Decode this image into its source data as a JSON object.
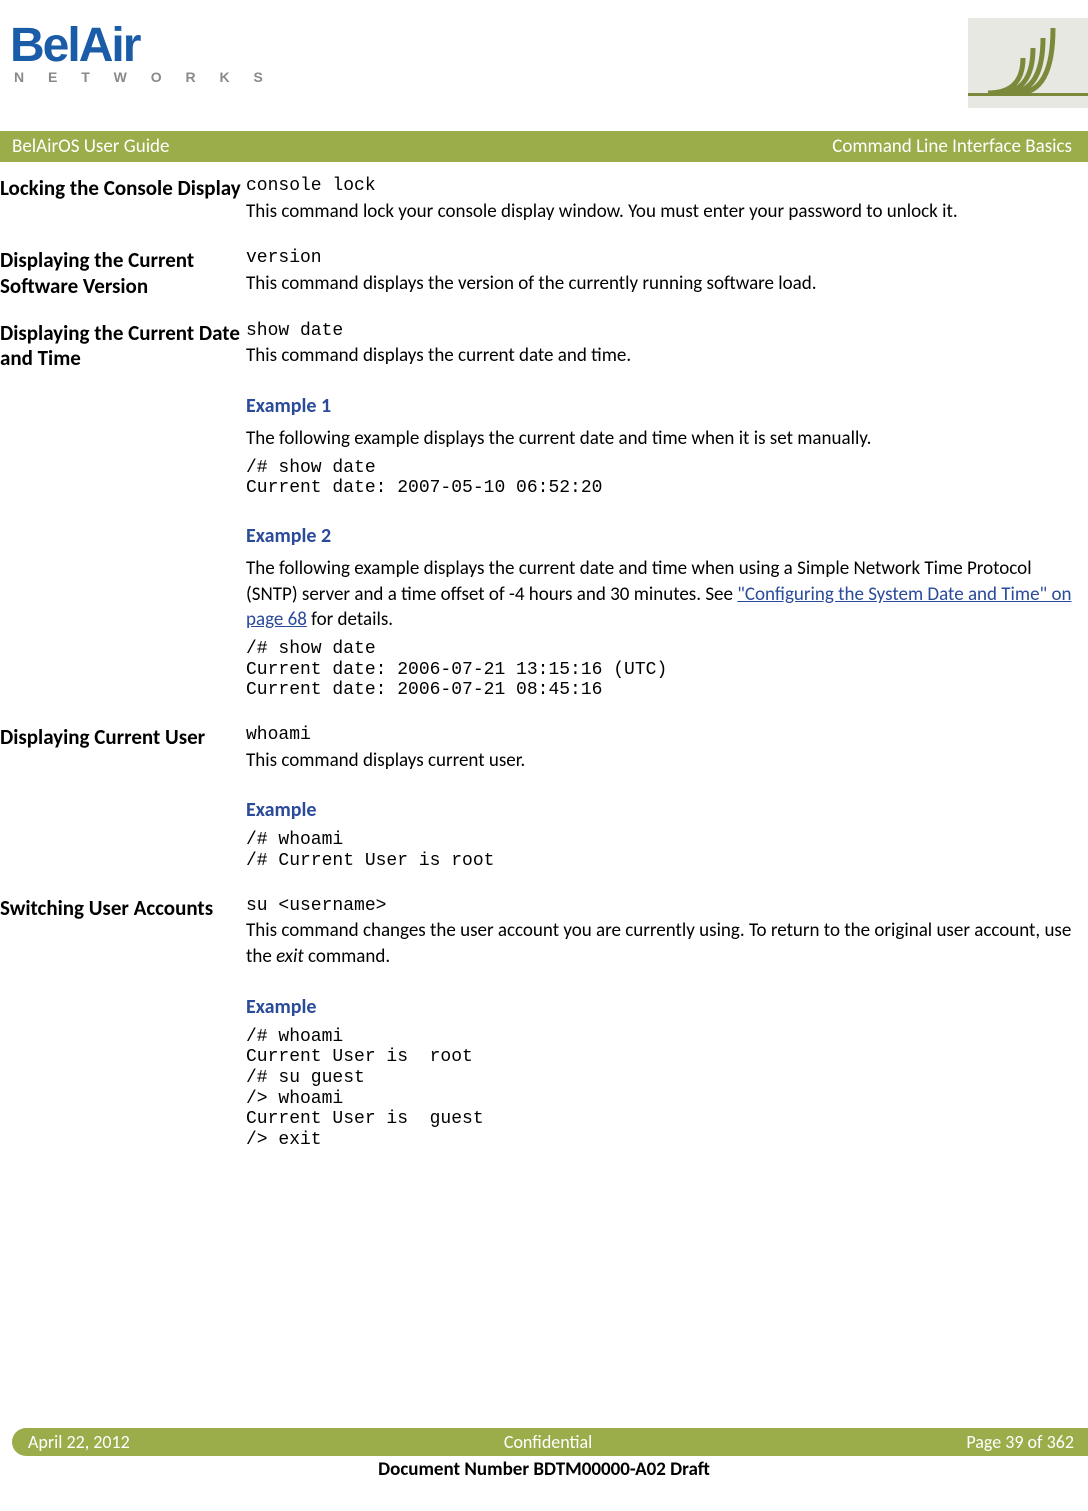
{
  "header": {
    "logo_main": "BelAir",
    "logo_sub": "N E T W O R K S"
  },
  "title_bar": {
    "left": "BelAirOS User Guide",
    "right": "Command Line Interface Basics"
  },
  "sections": [
    {
      "heading": "Locking the Console Display",
      "command": "console lock",
      "description": "This command lock your console display window. You must enter your password to unlock it."
    },
    {
      "heading": "Displaying the Current Software Version",
      "command": "version",
      "description": "This command displays the version of the currently running software load."
    },
    {
      "heading": "Displaying the Current Date and Time",
      "command": "show date",
      "description": "This command displays the current date and time.",
      "example1_heading": "Example 1",
      "example1_text": "The following example displays the current date and time when it is set manually.",
      "example1_code": "/# show date\nCurrent date: 2007-05-10 06:52:20",
      "example2_heading": "Example 2",
      "example2_text_pre": "The following example displays the current date and time when using a Simple Network Time Protocol (SNTP) server and a time offset of -4 hours and 30 minutes. See ",
      "example2_link": "\"Configuring the System Date and Time\" on page 68",
      "example2_text_post": " for details.",
      "example2_code": "/# show date\nCurrent date: 2006-07-21 13:15:16 (UTC)\nCurrent date: 2006-07-21 08:45:16"
    },
    {
      "heading": "Displaying Current User",
      "command": "whoami",
      "description": "This command displays current user.",
      "example_heading": "Example",
      "example_code": "/# whoami\n/# Current User is root"
    },
    {
      "heading": "Switching User Accounts",
      "command": "su <username>",
      "description_pre": "This command changes the user account you are currently using. To return to the original user account, use the ",
      "description_italic": "exit",
      "description_post": " command.",
      "example_heading": "Example",
      "example_code": "/# whoami\nCurrent User is  root\n/# su guest\n/> whoami\nCurrent User is  guest\n/> exit"
    }
  ],
  "footer": {
    "date": "April 22, 2012",
    "conf": "Confidential",
    "page": "Page 39 of 362",
    "doc": "Document Number BDTM00000-A02 Draft"
  }
}
